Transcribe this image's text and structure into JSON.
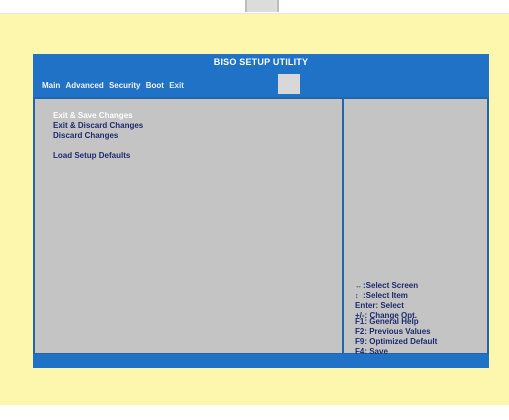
{
  "window": {
    "title": "BISO SETUP UTILITY"
  },
  "menu": {
    "items": [
      {
        "label": "Main",
        "active": false
      },
      {
        "label": "Advanced",
        "active": false
      },
      {
        "label": "Security",
        "active": false
      },
      {
        "label": "Boot",
        "active": false
      },
      {
        "label": "Exit",
        "active": true
      }
    ]
  },
  "options": {
    "items": [
      {
        "label": "Exit & Save Changes",
        "selected": true
      },
      {
        "label": "Exit & Discard Changes",
        "selected": false
      },
      {
        "label": "Discard Changes",
        "selected": false
      },
      {
        "label": "Load Setup Defaults",
        "selected": false
      }
    ]
  },
  "help": {
    "select_screen_icon": "left-right-arrows-icon",
    "select_screen": ":Select Screen",
    "select_item_icon": "up-down-arrows-icon",
    "select_item": ":Select Item",
    "enter": "Enter: Select",
    "change_opt": "+/-: Change Opt.",
    "f1": "F1: General Help",
    "f2": "F2: Previous Values",
    "f9": "F9: Optimized Default",
    "f4": "F4: Save"
  },
  "colors": {
    "background": "#fdf6ad",
    "bar": "#1f72c6",
    "panel": "#c4c4c4",
    "text": "#1e2b6e",
    "highlight": "#ffffff"
  }
}
